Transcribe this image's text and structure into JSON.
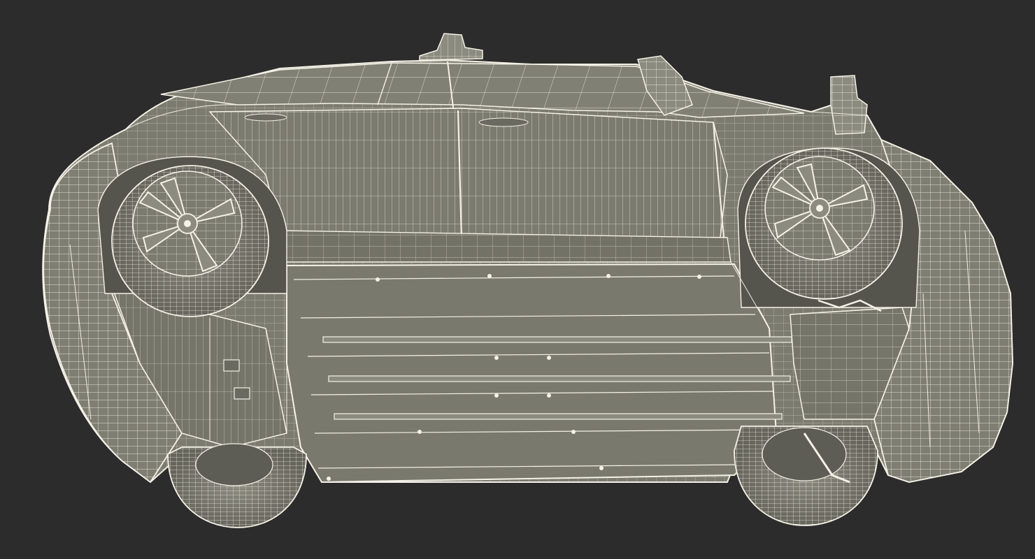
{
  "scene": {
    "subject": "car-wireframe-underside",
    "colors": {
      "background": "#2c2c2c",
      "surface": "#7c7b70",
      "surface_dark": "#6b6a60",
      "surface_light": "#8c8b80",
      "wire": "#f4f2e6",
      "wire_soft": "#dcdacd",
      "shadow": "#4a4a44"
    },
    "parts": [
      "roof",
      "side-body",
      "rear-wheel-top",
      "front-wheel-top",
      "rear-wheel-bottom",
      "front-wheel-bottom",
      "battery-floor-pan",
      "rear-bumper",
      "front-bumper",
      "antenna",
      "side-mirror"
    ]
  }
}
